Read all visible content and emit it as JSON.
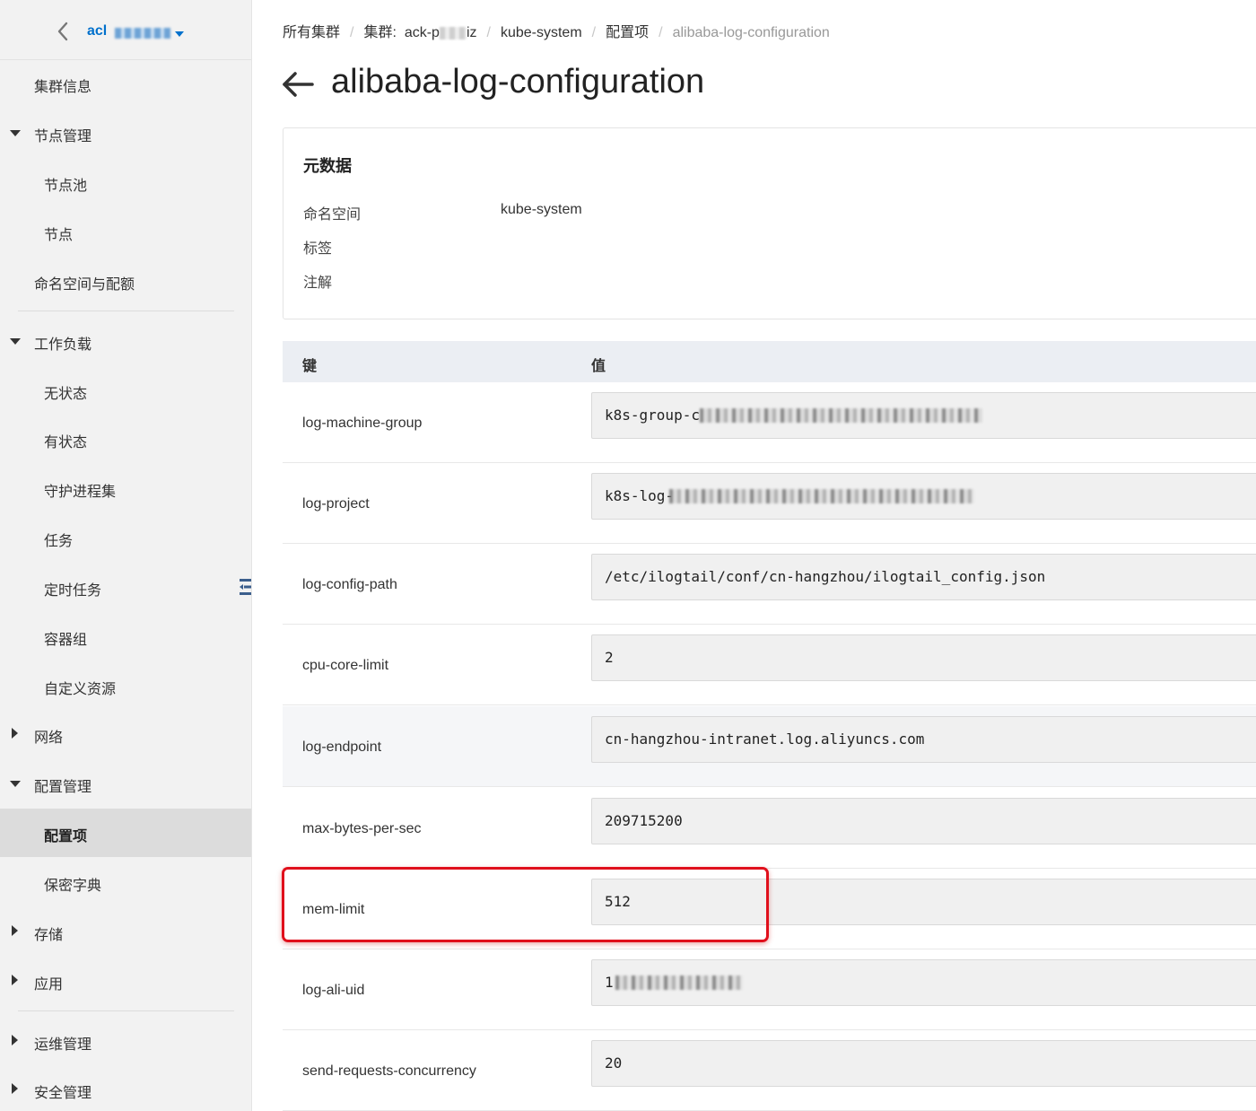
{
  "sidebar": {
    "cluster_prefix": "acl",
    "items": [
      {
        "label": "集群信息"
      },
      {
        "label": "节点管理"
      },
      {
        "label": "节点池"
      },
      {
        "label": "节点"
      },
      {
        "label": "命名空间与配额"
      },
      {
        "label": "工作负载"
      },
      {
        "label": "无状态"
      },
      {
        "label": "有状态"
      },
      {
        "label": "守护进程集"
      },
      {
        "label": "任务"
      },
      {
        "label": "定时任务"
      },
      {
        "label": "容器组"
      },
      {
        "label": "自定义资源"
      },
      {
        "label": "网络"
      },
      {
        "label": "配置管理"
      },
      {
        "label": "配置项"
      },
      {
        "label": "保密字典"
      },
      {
        "label": "存储"
      },
      {
        "label": "应用"
      },
      {
        "label": "运维管理"
      },
      {
        "label": "安全管理"
      }
    ]
  },
  "breadcrumb": {
    "all_clusters": "所有集群",
    "cluster_label": "集群:",
    "cluster_prefix": "ack-p",
    "cluster_suffix": "iz",
    "namespace": "kube-system",
    "configmaps": "配置项",
    "current": "alibaba-log-configuration"
  },
  "page": {
    "title": "alibaba-log-configuration"
  },
  "metadata": {
    "title": "元数据",
    "namespace_label": "命名空间",
    "namespace_value": "kube-system",
    "labels_label": "标签",
    "annotations_label": "注解"
  },
  "table": {
    "key_header": "键",
    "value_header": "值",
    "rows": [
      {
        "key": "log-machine-group",
        "value": "k8s-group-c",
        "redacted_tail": true
      },
      {
        "key": "log-project",
        "value": "k8s-log-",
        "redacted_tail": true
      },
      {
        "key": "log-config-path",
        "value": "/etc/ilogtail/conf/cn-hangzhou/ilogtail_config.json"
      },
      {
        "key": "cpu-core-limit",
        "value": "2"
      },
      {
        "key": "log-endpoint",
        "value": "cn-hangzhou-intranet.log.aliyuncs.com"
      },
      {
        "key": "max-bytes-per-sec",
        "value": "209715200"
      },
      {
        "key": "mem-limit",
        "value": "512",
        "highlighted": true
      },
      {
        "key": "log-ali-uid",
        "value": "1",
        "redacted_tail": true
      },
      {
        "key": "send-requests-concurrency",
        "value": "20"
      }
    ]
  },
  "colors": {
    "highlight": "#e0101c",
    "link": "#0070cc",
    "active_nav": "#dcdcdc"
  }
}
